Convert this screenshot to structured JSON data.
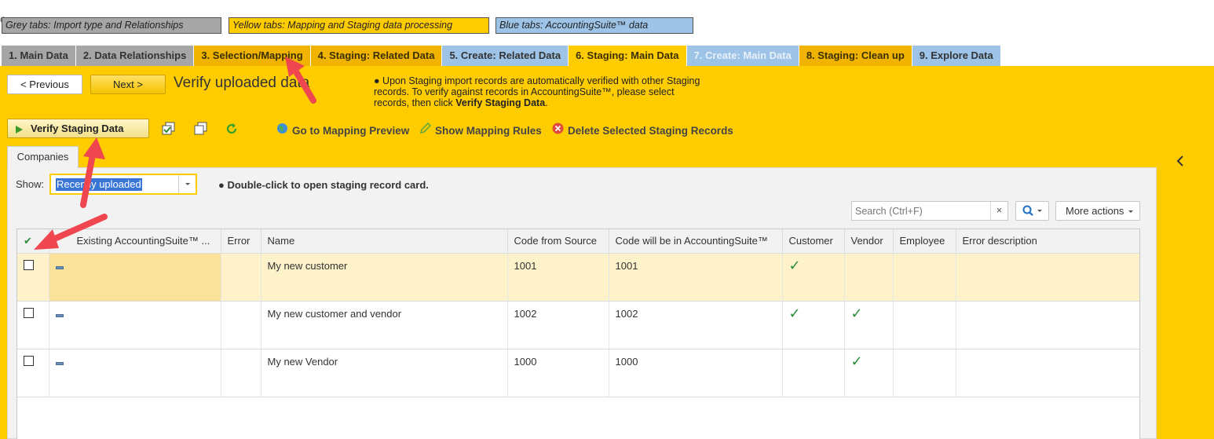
{
  "legend": {
    "corner": "C",
    "grey": "Grey tabs: Import type and Relationships",
    "yellow": "Yellow tabs: Mapping and Staging data processing",
    "blue": "Blue tabs: AccountingSuite™ data"
  },
  "tabs": [
    {
      "label": "1. Main Data",
      "group": "grey"
    },
    {
      "label": "2. Data Relationships",
      "group": "grey"
    },
    {
      "label": "3. Selection/Mapping",
      "group": "yellow"
    },
    {
      "label": "4. Staging: Related Data",
      "group": "yellow"
    },
    {
      "label": "5. Create: Related Data",
      "group": "blue"
    },
    {
      "label": "6. Staging: Main Data",
      "group": "yellow",
      "active": true
    },
    {
      "label": "7. Create: Main Data",
      "group": "blue",
      "disabled": true
    },
    {
      "label": "8. Staging: Clean up",
      "group": "yellow"
    },
    {
      "label": "9. Explore Data",
      "group": "blue"
    }
  ],
  "nav": {
    "previous": "< Previous",
    "next": "Next >",
    "heading": "Verify uploaded data"
  },
  "info": {
    "bullet": "●",
    "text": "Upon Staging import records are automatically verified with other Staging records. To verify against records in AccountingSuite™, please select records, then click",
    "bold": "Verify Staging Data",
    "end": "."
  },
  "toolbar": {
    "verify": "Verify Staging Data",
    "go_mapping": "Go to Mapping Preview",
    "show_rules": "Show Mapping Rules",
    "delete": "Delete Selected Staging Records"
  },
  "companies_tab": "Companies",
  "filter": {
    "show_label": "Show:",
    "show_value": "Recently uploaded",
    "hint": "● Double-click to open staging record card."
  },
  "search": {
    "placeholder": "Search (Ctrl+F)",
    "clear": "×",
    "more_actions": "More actions"
  },
  "grid": {
    "columns": [
      "",
      "Existing AccountingSuite™ ...",
      "Error",
      "Name",
      "Code from Source",
      "Code will be in AccountingSuite™",
      "Customer",
      "Vendor",
      "Employee",
      "Error description"
    ],
    "rows": [
      {
        "name": "My  new customer",
        "code_source": "1001",
        "code_as": "1001",
        "customer": true,
        "vendor": false,
        "employee": false,
        "selected": true
      },
      {
        "name": "My new customer and vendor",
        "code_source": "1002",
        "code_as": "1002",
        "customer": true,
        "vendor": true,
        "employee": false,
        "selected": false
      },
      {
        "name": "My new Vendor",
        "code_source": "1000",
        "code_as": "1000",
        "customer": false,
        "vendor": true,
        "employee": false,
        "selected": false
      }
    ]
  },
  "colors": {
    "yellow": "#ffcc00",
    "grey_tab": "#a6a6a6",
    "blue_tab": "#9dc3e6",
    "annotation_arrow": "#f0464f",
    "check": "#2e8b3a"
  }
}
